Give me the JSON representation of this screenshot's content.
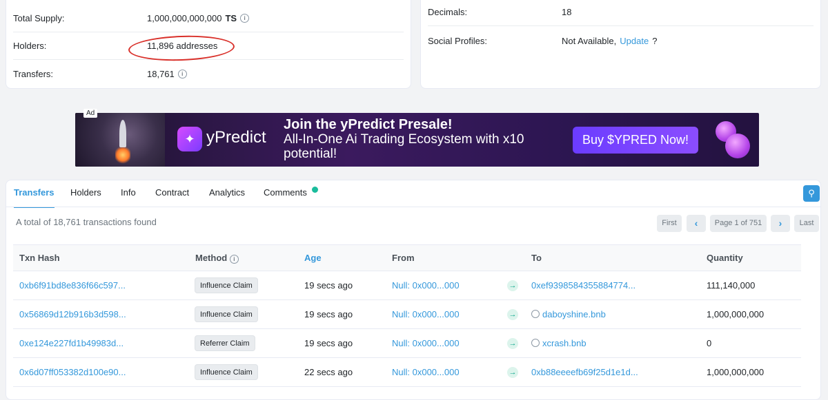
{
  "overview_left": {
    "rows": [
      {
        "label": "Total Supply:",
        "value": "1,000,000,000,000",
        "unit": "TS"
      },
      {
        "label": "Holders:",
        "value": "11,896 addresses"
      },
      {
        "label": "Transfers:",
        "value": "18,761"
      }
    ]
  },
  "overview_right": {
    "rows": [
      {
        "label": "Decimals:",
        "value": "18"
      },
      {
        "label": "Social Profiles:",
        "value": "Not Available,",
        "link": "Update",
        "suffix": "?"
      }
    ]
  },
  "ad": {
    "tag": "Ad",
    "brand": "yPredict",
    "headline": "Join the yPredict Presale!",
    "subline": "All-In-One Ai Trading Ecosystem with x10 potential!",
    "cta": "Buy $YPRED Now!"
  },
  "tabs": [
    {
      "label": "Transfers",
      "active": true
    },
    {
      "label": "Holders"
    },
    {
      "label": "Info"
    },
    {
      "label": "Contract"
    },
    {
      "label": "Analytics"
    },
    {
      "label": "Comments"
    }
  ],
  "summary": "A total of 18,761 transactions found",
  "pagination": {
    "first": "First",
    "prev": "‹",
    "page": "Page 1 of 751",
    "next": "›",
    "last": "Last"
  },
  "table": {
    "headers": {
      "hash": "Txn Hash",
      "method": "Method",
      "age": "Age",
      "from": "From",
      "to": "To",
      "quantity": "Quantity"
    },
    "rows": [
      {
        "hash": "0xb6f91bd8e836f66c597...",
        "method": "Influence Claim",
        "age": "19 secs ago",
        "from": "Null: 0x000...000",
        "to": "0xef9398584355884774...",
        "to_icon": false,
        "quantity": "111,140,000"
      },
      {
        "hash": "0x56869d12b916b3d598...",
        "method": "Influence Claim",
        "age": "19 secs ago",
        "from": "Null: 0x000...000",
        "to": "daboyshine.bnb",
        "to_icon": true,
        "quantity": "1,000,000,000"
      },
      {
        "hash": "0xe124e227fd1b49983d...",
        "method": "Referrer Claim",
        "age": "19 secs ago",
        "from": "Null: 0x000...000",
        "to": "xcrash.bnb",
        "to_icon": true,
        "quantity": "0"
      },
      {
        "hash": "0x6d07ff053382d100e90...",
        "method": "Influence Claim",
        "age": "22 secs ago",
        "from": "Null: 0x000...000",
        "to": "0xb88eeeefb69f25d1e1d...",
        "to_icon": false,
        "quantity": "1,000,000,000"
      }
    ]
  },
  "colors": {
    "accent": "#3498db",
    "annotation": "#d9302a",
    "status_dot": "#1abc9c"
  }
}
